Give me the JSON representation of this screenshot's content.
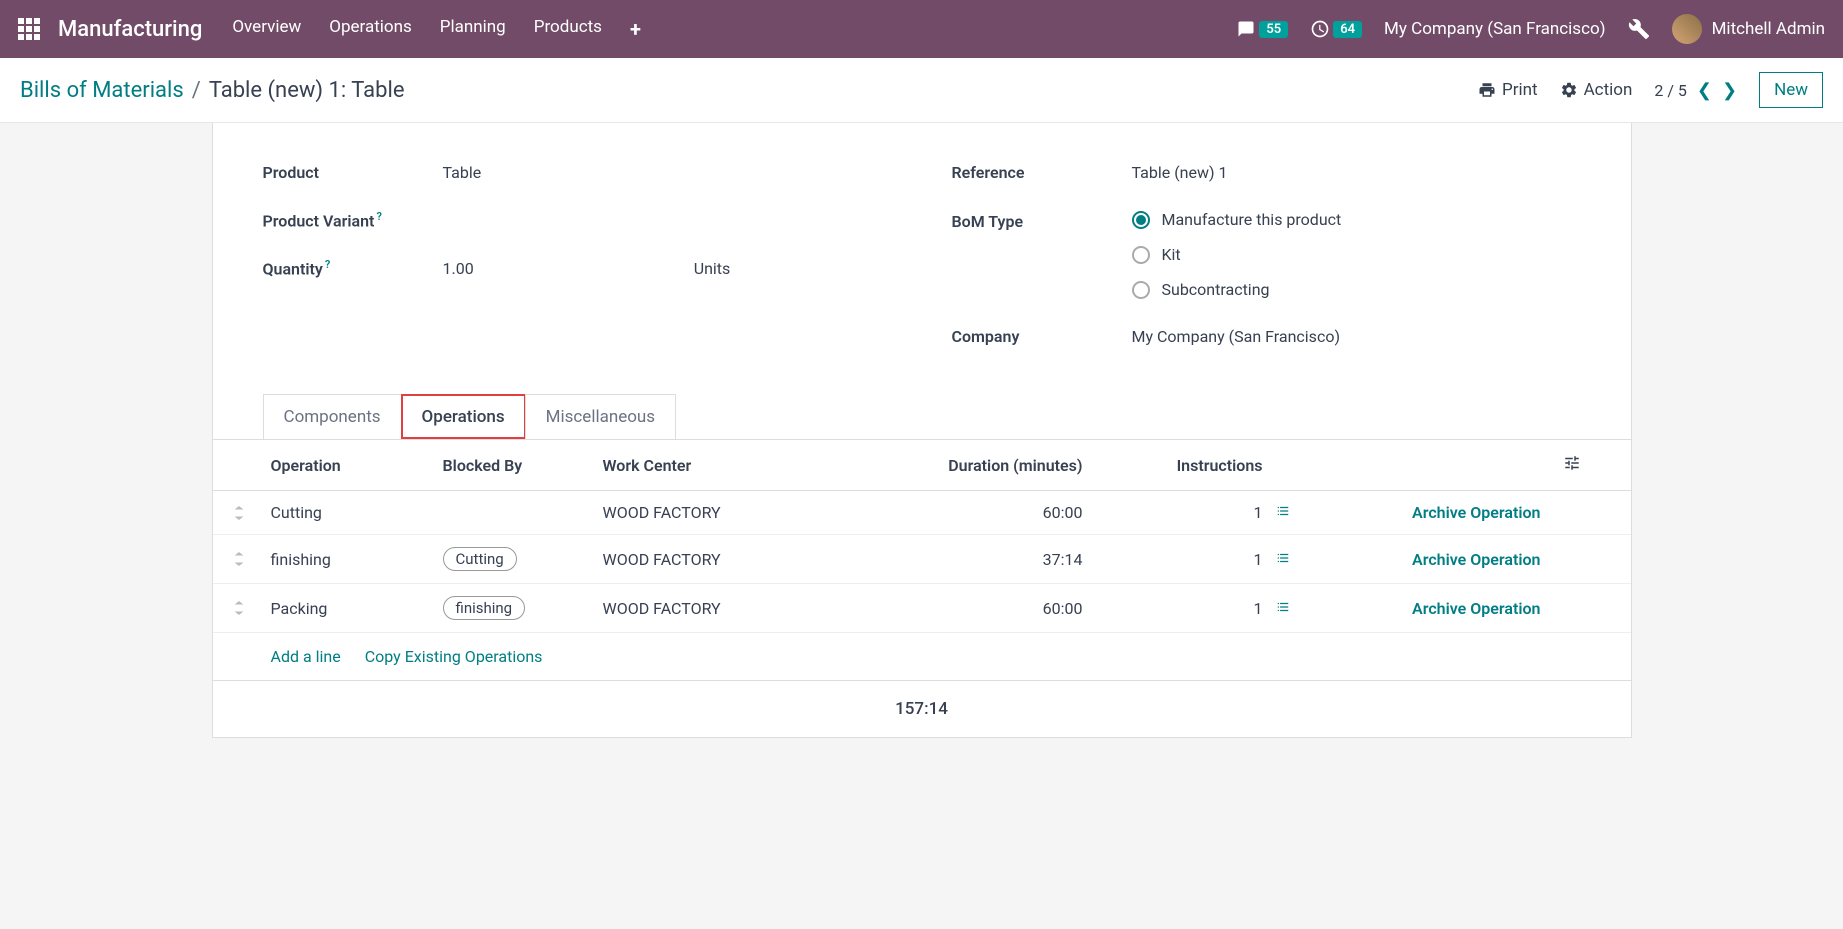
{
  "header": {
    "app_title": "Manufacturing",
    "nav": [
      "Overview",
      "Operations",
      "Planning",
      "Products"
    ],
    "msg_count": "55",
    "activity_count": "64",
    "company": "My Company (San Francisco)",
    "user": "Mitchell Admin"
  },
  "breadcrumb": {
    "parent": "Bills of Materials",
    "current": "Table (new) 1: Table",
    "print": "Print",
    "action": "Action",
    "pager": "2 / 5",
    "new": "New"
  },
  "form": {
    "labels": {
      "product": "Product",
      "variant": "Product Variant",
      "quantity": "Quantity",
      "reference": "Reference",
      "bom_type": "BoM Type",
      "company": "Company"
    },
    "values": {
      "product": "Table",
      "quantity": "1.00",
      "quantity_uom": "Units",
      "reference": "Table (new) 1",
      "company": "My Company (San Francisco)"
    },
    "bom_types": {
      "manufacture": "Manufacture this product",
      "kit": "Kit",
      "subcontract": "Subcontracting"
    }
  },
  "tabs": {
    "components": "Components",
    "operations": "Operations",
    "misc": "Miscellaneous"
  },
  "table": {
    "headers": {
      "operation": "Operation",
      "blocked": "Blocked By",
      "wc": "Work Center",
      "duration": "Duration (minutes)",
      "instructions": "Instructions"
    },
    "rows": [
      {
        "op": "Cutting",
        "blocked": "",
        "wc": "WOOD FACTORY",
        "dur": "60:00",
        "inst": "1",
        "archive": "Archive Operation"
      },
      {
        "op": "finishing",
        "blocked": "Cutting",
        "wc": "WOOD FACTORY",
        "dur": "37:14",
        "inst": "1",
        "archive": "Archive Operation"
      },
      {
        "op": "Packing",
        "blocked": "finishing",
        "wc": "WOOD FACTORY",
        "dur": "60:00",
        "inst": "1",
        "archive": "Archive Operation"
      }
    ],
    "add_line": "Add a line",
    "copy_ops": "Copy Existing Operations",
    "total": "157:14"
  }
}
